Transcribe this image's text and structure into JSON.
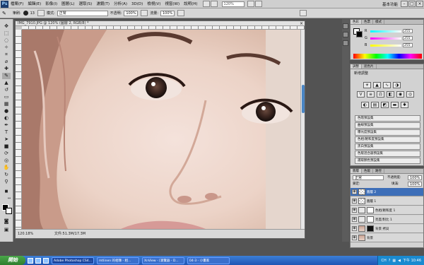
{
  "menubar": {
    "logo": "Ps",
    "items": [
      "檔案(F)",
      "編輯(E)",
      "影像(I)",
      "圖層(L)",
      "選取(S)",
      "濾鏡(T)",
      "分析(A)",
      "3D(D)",
      "檢視(V)",
      "視窗(W)",
      "說明(H)"
    ],
    "zoom": "120%",
    "workspace": "基本功能"
  },
  "options": {
    "brush_label": "筆刷:",
    "size": "13",
    "mode_label": "模式:",
    "mode": "正常",
    "opacity_label": "不透明:",
    "opacity": "100%",
    "flow_label": "流量:",
    "flow": "100%"
  },
  "document": {
    "title": "IMG_7910.JPG @ 120% (圖層 2, RGB/8) *",
    "zoom": "120.18%",
    "info": "文件:51.3M/17.3M"
  },
  "color_panel": {
    "tabs": [
      "色彩",
      "色票",
      "樣式"
    ],
    "channels": [
      {
        "label": "R",
        "value": "255"
      },
      {
        "label": "G",
        "value": "255"
      },
      {
        "label": "B",
        "value": "255"
      }
    ]
  },
  "adjust_panel": {
    "tabs": [
      "調整",
      "遮色片"
    ],
    "title": "新增調整",
    "presets": [
      "色階預設集",
      "曲線預設集",
      "曝光度預設集",
      "色相/飽和度預設集",
      "黑白預設集",
      "色版混合器預設集",
      "選取顏色預設集"
    ]
  },
  "layers_panel": {
    "tabs": [
      "圖層",
      "色版",
      "路徑"
    ],
    "blend_mode": "正常",
    "opacity_label": "不透明度:",
    "opacity": "100%",
    "lock_label": "鎖定:",
    "fill_label": "填滿:",
    "fill": "100%",
    "layers": [
      {
        "name": "圖層 2",
        "selected": true
      },
      {
        "name": "圖層 1",
        "selected": false
      },
      {
        "name": "色相/飽和度 1",
        "selected": false
      },
      {
        "name": "亮度/對比 1",
        "selected": false
      },
      {
        "name": "背景 拷貝",
        "selected": false
      },
      {
        "name": "背景",
        "selected": false
      }
    ]
  },
  "taskbar": {
    "start": "開始",
    "tasks": [
      "Adobe Photoshop CS4...",
      "mtlinen 的相簿 - 相...",
      "XnView - [瀏覽器 - D...",
      "04-3 - 小畫家"
    ],
    "lang": "CH",
    "time": "下午 10:46"
  },
  "colors": {
    "selection": "#3d6eb8",
    "taskbar": "#245edb"
  }
}
